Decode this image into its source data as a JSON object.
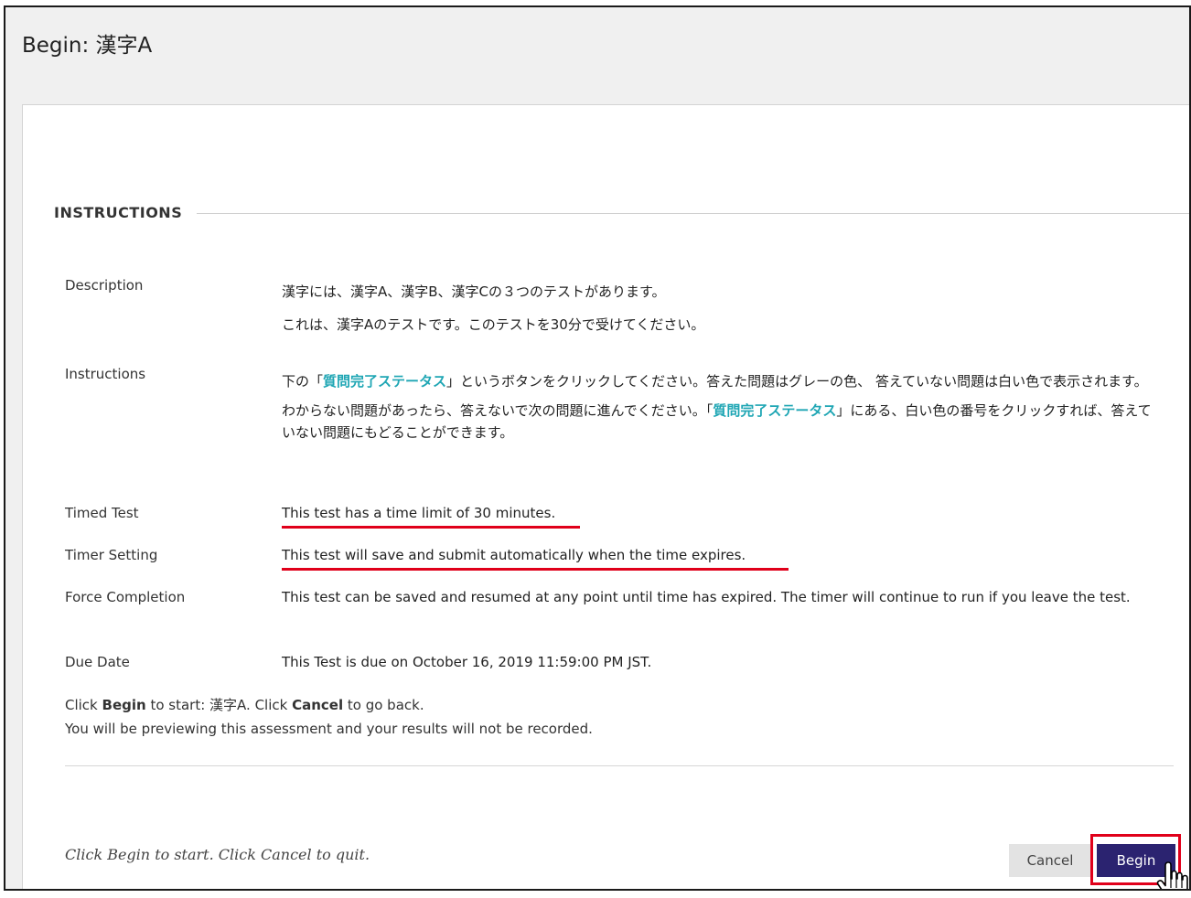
{
  "page": {
    "title": "Begin: 漢字A"
  },
  "instructions": {
    "heading": "INSTRUCTIONS",
    "rows": [
      {
        "label": "Description",
        "lines": [
          "漢字には、漢字A、漢字B、漢字Cの３つのテストがあります。",
          "これは、漢字Aのテストです。このテストを30分で受けてください。"
        ]
      },
      {
        "label": "Instructions",
        "p1_pre": "下の「",
        "p1_link": "質問完了ステータス",
        "p1_post": "」というボタンをクリックしてください。答えた問題はグレーの色、 答えていない問題は白い色で表示されます。",
        "p2_pre": "わからない問題があったら、答えないで次の問題に進んでください。「",
        "p2_link": "質問完了ステータス",
        "p2_post": "」にある、白い色の番号をクリックすれば、答えていない問題にもどることができます。"
      },
      {
        "label": "Timed Test",
        "value": "This test has a time limit of 30 minutes."
      },
      {
        "label": "Timer Setting",
        "value": "This test will save and submit automatically when the time expires."
      },
      {
        "label": "Force Completion",
        "value": "This test can be saved and resumed at any point until time has expired. The timer will continue to run if you leave the test."
      },
      {
        "label": "Due Date",
        "value": "This Test is due on October 16, 2019 11:59:00 PM JST."
      }
    ]
  },
  "begin_note": {
    "click": "Click ",
    "begin": "Begin",
    "to_start": " to start: 漢字A. Click ",
    "cancel": "Cancel",
    "to_go_back": " to go back.",
    "preview": "You will be previewing this assessment and your results will not be recorded."
  },
  "footer": {
    "note": "Click Begin to start. Click Cancel to quit.",
    "cancel_label": "Cancel",
    "begin_label": "Begin"
  },
  "colors": {
    "begin_button": "#2b2370",
    "link": "#1fa6b4",
    "annotation": "#e0001a"
  },
  "icons": {
    "cursor": "hand-pointer-icon"
  }
}
